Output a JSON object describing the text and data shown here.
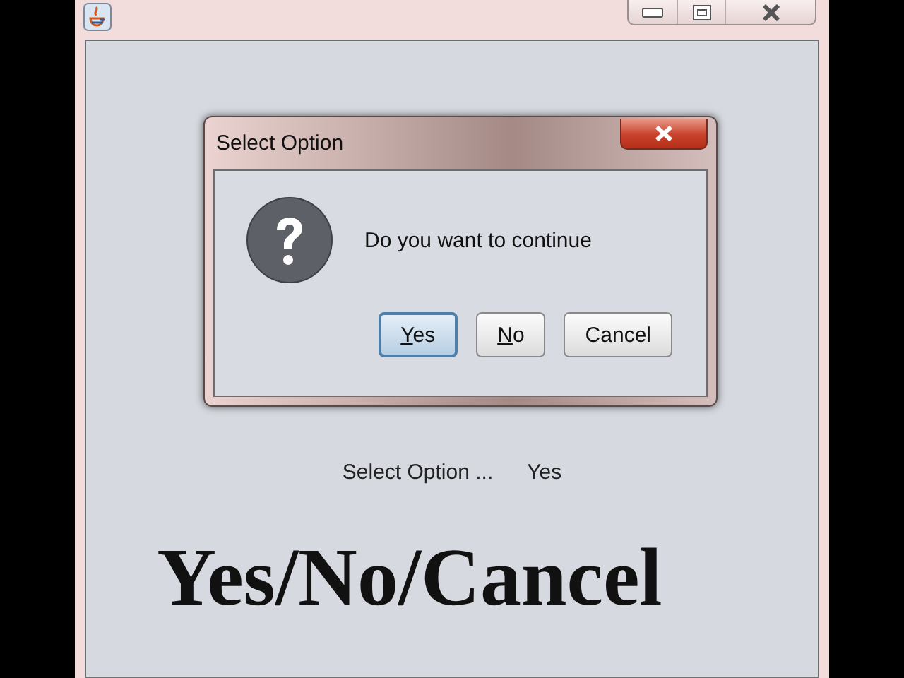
{
  "window": {
    "controls": [
      {
        "kind": "minimize"
      },
      {
        "kind": "maximize"
      },
      {
        "kind": "close"
      }
    ]
  },
  "dialog": {
    "title": "Select Option",
    "message": "Do you want to continue",
    "buttons": [
      {
        "label": "Yes",
        "selected": true,
        "mnemonic": true
      },
      {
        "label": "No",
        "selected": false,
        "mnemonic": true
      },
      {
        "label": "Cancel",
        "selected": false,
        "mnemonic": false
      }
    ]
  },
  "result": {
    "label": "Select Option ...",
    "value": "Yes"
  },
  "caption": "Yes/No/Cancel"
}
